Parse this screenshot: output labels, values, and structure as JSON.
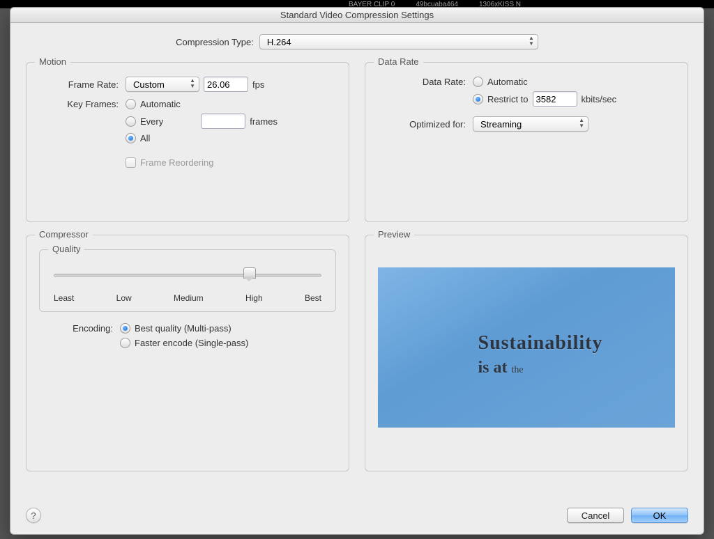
{
  "backdrop": {
    "t1": "BAYER CLIP 0",
    "t2": "49bcuaba464",
    "t3": "1306xKISS N"
  },
  "window": {
    "title": "Standard Video Compression Settings"
  },
  "compression": {
    "label": "Compression Type:",
    "value": "H.264"
  },
  "motion": {
    "legend": "Motion",
    "frame_rate_label": "Frame Rate:",
    "frame_rate_select": "Custom",
    "frame_rate_value": "26.06",
    "fps": "fps",
    "key_frames_label": "Key Frames:",
    "kf_auto": "Automatic",
    "kf_every": "Every",
    "kf_every_value": "",
    "kf_frames": "frames",
    "kf_all": "All",
    "frame_reordering": "Frame Reordering"
  },
  "data_rate": {
    "legend": "Data Rate",
    "label": "Data Rate:",
    "automatic": "Automatic",
    "restrict_to": "Restrict to",
    "restrict_value": "3582",
    "kbits": "kbits/sec",
    "optimized_label": "Optimized for:",
    "optimized_value": "Streaming"
  },
  "compressor": {
    "legend": "Compressor",
    "quality_legend": "Quality",
    "ticks": {
      "least": "Least",
      "low": "Low",
      "medium": "Medium",
      "high": "High",
      "best": "Best"
    },
    "encoding_label": "Encoding:",
    "best_quality": "Best quality (Multi-pass)",
    "faster": "Faster encode (Single-pass)"
  },
  "preview": {
    "legend": "Preview",
    "line1": "Sustainability",
    "line2a": "is at",
    "line2b": "the"
  },
  "footer": {
    "help": "?",
    "cancel": "Cancel",
    "ok": "OK"
  }
}
